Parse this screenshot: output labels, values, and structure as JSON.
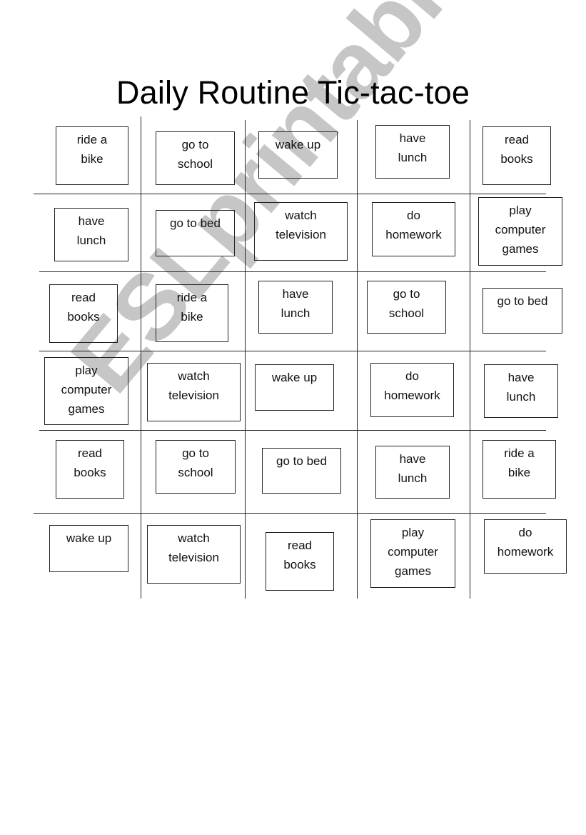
{
  "title": "Daily Routine Tic-tac-toe",
  "watermark": "ESLprintables.com",
  "cards": [
    {
      "row": 1,
      "col": 1,
      "lines": [
        "ride a",
        "bike"
      ]
    },
    {
      "row": 1,
      "col": 2,
      "lines": [
        "go to",
        "school"
      ]
    },
    {
      "row": 1,
      "col": 3,
      "lines": [
        "wake up"
      ]
    },
    {
      "row": 1,
      "col": 4,
      "lines": [
        "have",
        "lunch"
      ]
    },
    {
      "row": 1,
      "col": 5,
      "lines": [
        "read",
        "books"
      ]
    },
    {
      "row": 2,
      "col": 1,
      "lines": [
        "have",
        "lunch"
      ]
    },
    {
      "row": 2,
      "col": 2,
      "lines": [
        "go to bed"
      ]
    },
    {
      "row": 2,
      "col": 3,
      "lines": [
        "watch",
        "television"
      ]
    },
    {
      "row": 2,
      "col": 4,
      "lines": [
        "do",
        "homework"
      ]
    },
    {
      "row": 2,
      "col": 5,
      "lines": [
        "play",
        "computer",
        "games"
      ]
    },
    {
      "row": 3,
      "col": 1,
      "lines": [
        "read",
        "books"
      ]
    },
    {
      "row": 3,
      "col": 2,
      "lines": [
        "ride a",
        "bike"
      ]
    },
    {
      "row": 3,
      "col": 3,
      "lines": [
        "have",
        "lunch"
      ]
    },
    {
      "row": 3,
      "col": 4,
      "lines": [
        "go to",
        "school"
      ]
    },
    {
      "row": 3,
      "col": 5,
      "lines": [
        "go to bed"
      ]
    },
    {
      "row": 4,
      "col": 1,
      "lines": [
        "play",
        "computer",
        "games"
      ]
    },
    {
      "row": 4,
      "col": 2,
      "lines": [
        "watch",
        "television"
      ]
    },
    {
      "row": 4,
      "col": 3,
      "lines": [
        "wake up"
      ]
    },
    {
      "row": 4,
      "col": 4,
      "lines": [
        "do",
        "homework"
      ]
    },
    {
      "row": 4,
      "col": 5,
      "lines": [
        "have",
        "lunch"
      ]
    },
    {
      "row": 5,
      "col": 1,
      "lines": [
        "read",
        "books"
      ]
    },
    {
      "row": 5,
      "col": 2,
      "lines": [
        "go to",
        "school"
      ]
    },
    {
      "row": 5,
      "col": 3,
      "lines": [
        "go to bed"
      ]
    },
    {
      "row": 5,
      "col": 4,
      "lines": [
        "have",
        "lunch"
      ]
    },
    {
      "row": 5,
      "col": 5,
      "lines": [
        "ride a",
        "bike"
      ]
    },
    {
      "row": 6,
      "col": 1,
      "lines": [
        "wake up"
      ]
    },
    {
      "row": 6,
      "col": 2,
      "lines": [
        "watch",
        "television"
      ]
    },
    {
      "row": 6,
      "col": 3,
      "lines": [
        "read",
        "books"
      ]
    },
    {
      "row": 6,
      "col": 4,
      "lines": [
        "play",
        "computer",
        "games"
      ]
    },
    {
      "row": 6,
      "col": 5,
      "lines": [
        "do",
        "homework"
      ]
    }
  ]
}
